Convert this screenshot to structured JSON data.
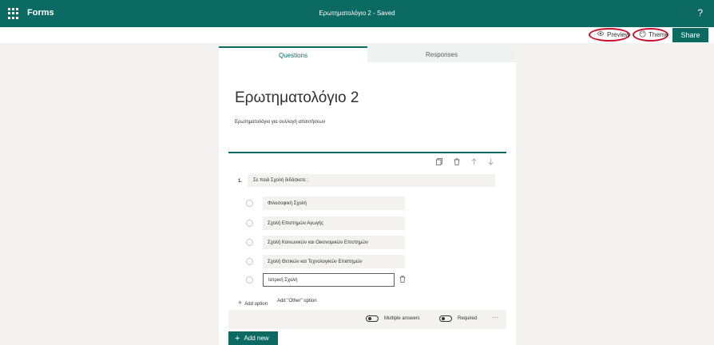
{
  "header": {
    "app_name": "Forms",
    "doc_title": "Ερωτηματολόγιο 2 - Saved",
    "help": "?"
  },
  "toolbar": {
    "preview_label": "Preview",
    "theme_label": "Theme",
    "share_label": "Share",
    "preview_icon": "eye-icon",
    "theme_icon": "palette-icon"
  },
  "tabs": [
    {
      "label": "Questions",
      "active": true
    },
    {
      "label": "Responses",
      "active": false
    }
  ],
  "form": {
    "title": "Ερωτηματολόγιο 2",
    "description": "Ερωτηματολόγιο για συλλογή απαντήσεων"
  },
  "question": {
    "number": "1.",
    "text": "Σε ποιά Σχολή διδάσκετε ;",
    "options": [
      "Φιλοσοφική Σχολή",
      "Σχολή Επιστημών Αγωγής",
      "Σχολή Κοινωνικών και Οικονομικών Επιστημών",
      "Σχολή Θετικών και Τεχνολογικών Επιστημών",
      "Ιατρική Σχολή"
    ],
    "add_option": "Add option",
    "add_other": "Add \"Other\" option",
    "multiple_answers": "Multiple answers",
    "required": "Required",
    "more": "···"
  },
  "add_new": "Add new",
  "colors": {
    "brand": "#0b6a62",
    "highlight_ring": "#c8102e"
  }
}
